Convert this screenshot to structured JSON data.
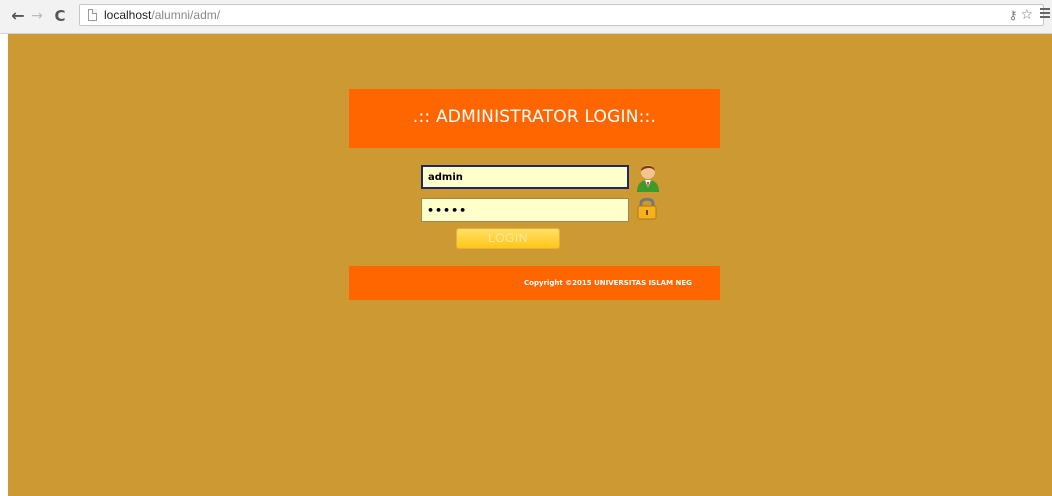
{
  "browser": {
    "back_icon": "arrow-left-icon",
    "forward_icon": "arrow-right-icon",
    "reload_icon": "reload-icon",
    "url_host": "localhost",
    "url_path": "/alumni/adm/",
    "extension_icon": "key-icon",
    "bookmark_icon": "star-icon",
    "menu_icon": "hamburger-menu-icon"
  },
  "page": {
    "background_color": "#cc9933",
    "accent_color": "#ff6600",
    "header_title": ".:: ADMINISTRATOR LOGIN::.",
    "username_value": "admin",
    "password_value": "•••••",
    "login_label": "LOGIN",
    "copyright": "Copyright ©2015 UNIVERSITAS ISLAM NEG"
  }
}
